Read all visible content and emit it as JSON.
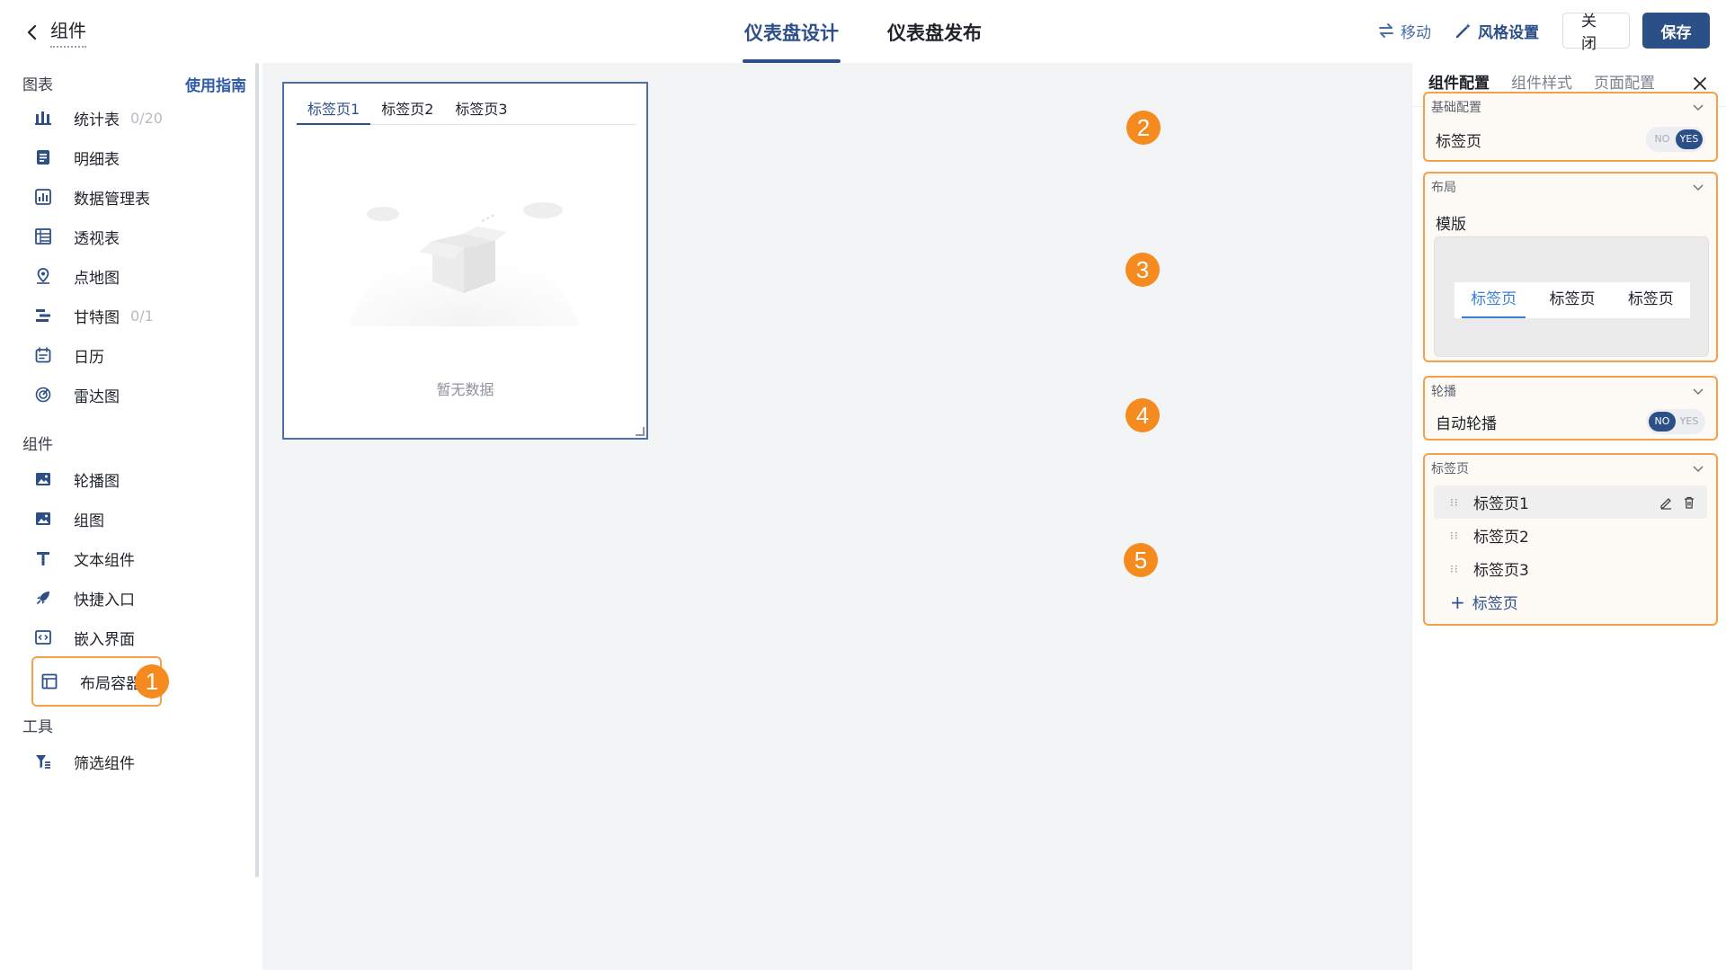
{
  "header": {
    "back_title": "组件",
    "tabs": [
      {
        "label": "仪表盘设计",
        "active": true
      },
      {
        "label": "仪表盘发布",
        "active": false
      }
    ],
    "move_label": "移动",
    "style_label": "风格设置",
    "close_label": "关闭",
    "save_label": "保存"
  },
  "sidebar": {
    "charts_heading": "图表",
    "guide_label": "使用指南",
    "charts": [
      {
        "label": "统计表",
        "count": "0/20",
        "icon": "bar-chart-icon"
      },
      {
        "label": "明细表",
        "count": "",
        "icon": "detail-table-icon"
      },
      {
        "label": "数据管理表",
        "count": "",
        "icon": "data-manage-icon"
      },
      {
        "label": "透视表",
        "count": "",
        "icon": "pivot-table-icon"
      },
      {
        "label": "点地图",
        "count": "",
        "icon": "map-pin-icon"
      },
      {
        "label": "甘特图",
        "count": "0/1",
        "icon": "gantt-icon"
      },
      {
        "label": "日历",
        "count": "",
        "icon": "calendar-icon"
      },
      {
        "label": "雷达图",
        "count": "",
        "icon": "radar-icon"
      }
    ],
    "components_heading": "组件",
    "components": [
      {
        "label": "轮播图",
        "icon": "carousel-image-icon"
      },
      {
        "label": "组图",
        "icon": "image-group-icon"
      },
      {
        "label": "文本组件",
        "icon": "text-icon"
      },
      {
        "label": "快捷入口",
        "icon": "rocket-icon"
      },
      {
        "label": "嵌入界面",
        "icon": "embed-code-icon"
      },
      {
        "label": "布局容器",
        "icon": "layout-icon"
      }
    ],
    "tools_heading": "工具",
    "tools": [
      {
        "label": "筛选组件",
        "icon": "filter-icon"
      }
    ]
  },
  "canvas": {
    "widget_tabs": [
      {
        "label": "标签页1",
        "active": true
      },
      {
        "label": "标签页2",
        "active": false
      },
      {
        "label": "标签页3",
        "active": false
      }
    ],
    "empty_text": "暂无数据"
  },
  "panel": {
    "tabs": [
      {
        "label": "组件配置",
        "active": true
      },
      {
        "label": "组件样式",
        "active": false
      },
      {
        "label": "页面配置",
        "active": false
      }
    ],
    "basic": {
      "title": "基础配置",
      "tabs_label": "标签页",
      "tabs_enabled": true
    },
    "layout": {
      "title": "布局",
      "template_label": "模版",
      "template_tabs": [
        "标签页",
        "标签页",
        "标签页"
      ]
    },
    "carousel": {
      "title": "轮播",
      "auto_label": "自动轮播",
      "auto_enabled": false
    },
    "tabs_section": {
      "title": "标签页",
      "items": [
        "标签页1",
        "标签页2",
        "标签页3"
      ],
      "add_label": "标签页"
    },
    "switch_no": "NO",
    "switch_yes": "YES"
  },
  "callouts": [
    "1",
    "2",
    "3",
    "4",
    "5"
  ],
  "colors": {
    "accent": "#2b4f86",
    "highlight": "#f5a14a",
    "badge": "#f58b1f",
    "canvas_bg": "#f3f4f6"
  }
}
